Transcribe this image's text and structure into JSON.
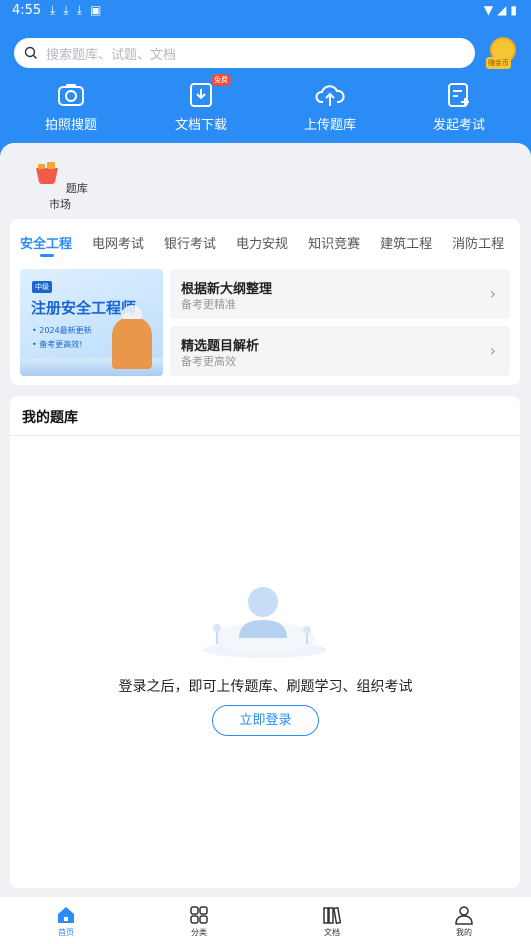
{
  "status_bar": {
    "time": "4:55"
  },
  "search": {
    "placeholder": "搜索题库、试题、文档"
  },
  "coin": {
    "label": "赚金币"
  },
  "quick_actions": [
    {
      "label": "拍照搜题",
      "icon": "camera-icon"
    },
    {
      "label": "文档下载",
      "icon": "download-doc-icon",
      "badge": "免费"
    },
    {
      "label": "上传题库",
      "icon": "upload-cloud-icon"
    },
    {
      "label": "发起考试",
      "icon": "exam-add-icon"
    }
  ],
  "market": {
    "label": "题库市场",
    "icon": "cart-icon"
  },
  "tabs": [
    "安全工程",
    "电网考试",
    "银行考试",
    "电力安规",
    "知识竞赛",
    "建筑工程",
    "消防工程"
  ],
  "active_tab": "安全工程",
  "banner": {
    "tag": "中级",
    "title": "注册安全工程师",
    "line1": "• 2024最新更新",
    "line2": "• 备考更高效!"
  },
  "features": [
    {
      "title": "根据新大纲整理",
      "subtitle": "备考更精准"
    },
    {
      "title": "精选题目解析",
      "subtitle": "备考更高效"
    }
  ],
  "my_bank": {
    "title": "我的题库",
    "empty_text": "登录之后，即可上传题库、刷题学习、组织考试",
    "login_button": "立即登录"
  },
  "bottom_nav": [
    {
      "label": "首页",
      "icon": "home-icon",
      "active": true
    },
    {
      "label": "分类",
      "icon": "grid-icon",
      "active": false
    },
    {
      "label": "文档",
      "icon": "books-icon",
      "active": false
    },
    {
      "label": "我的",
      "icon": "user-icon",
      "active": false
    }
  ],
  "colors": {
    "primary": "#2a8cf4",
    "background": "#f0f1f5",
    "badge": "#f04d3b"
  }
}
